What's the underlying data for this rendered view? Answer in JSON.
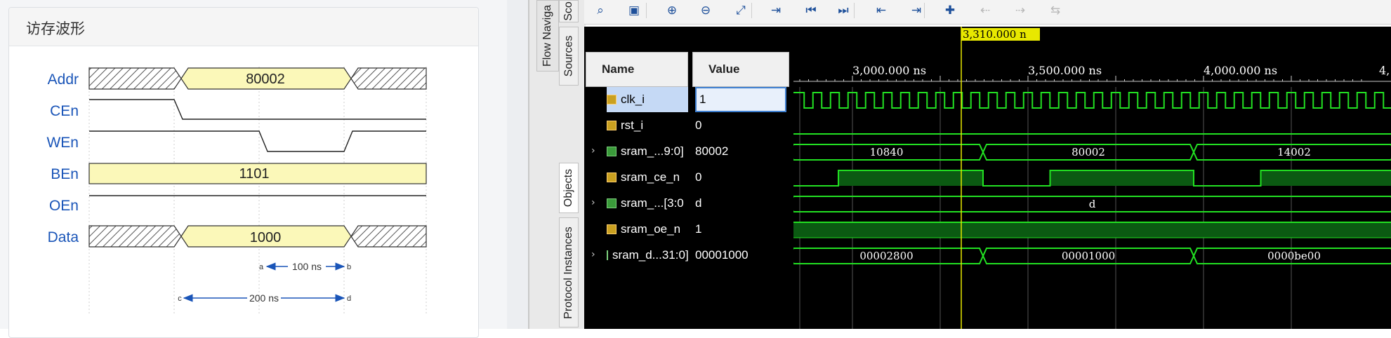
{
  "doc": {
    "title": "访存波形",
    "signals": [
      "Addr",
      "CEn",
      "WEn",
      "BEn",
      "OEn",
      "Data"
    ],
    "addr_value": "80002",
    "ben_value": "1101",
    "data_value": "1000",
    "annotations": {
      "a": "a",
      "b": "b",
      "c": "c",
      "d": "d",
      "short_span": "100 ns",
      "long_span": "200 ns"
    }
  },
  "side_tabs": [
    "Sco",
    "Flow Naviga",
    "Sources",
    "Objects",
    "Protocol Instances"
  ],
  "toolbar": {
    "buttons": [
      {
        "name": "search-button",
        "icon": "search-icon",
        "enabled": true
      },
      {
        "name": "save-button",
        "icon": "save-icon",
        "enabled": true
      },
      {
        "name": "zoom-in-button",
        "icon": "zoom-in-icon",
        "enabled": true
      },
      {
        "name": "zoom-out-button",
        "icon": "zoom-out-icon",
        "enabled": true
      },
      {
        "name": "zoom-fit-button",
        "icon": "zoom-fit-icon",
        "enabled": true
      },
      {
        "name": "go-to-cursor-button",
        "icon": "go-to-cursor-icon",
        "enabled": true
      },
      {
        "name": "go-to-time-0-button",
        "icon": "go-to-start-icon",
        "enabled": true
      },
      {
        "name": "go-to-last-time-button",
        "icon": "go-to-end-icon",
        "enabled": true
      },
      {
        "name": "previous-transition-button",
        "icon": "previous-transition-icon",
        "enabled": true
      },
      {
        "name": "next-transition-button",
        "icon": "next-transition-icon",
        "enabled": true
      },
      {
        "name": "add-marker-button",
        "icon": "add-marker-icon",
        "enabled": true
      },
      {
        "name": "previous-marker-button",
        "icon": "previous-marker-icon",
        "enabled": false
      },
      {
        "name": "next-marker-button",
        "icon": "next-marker-icon",
        "enabled": false
      },
      {
        "name": "swap-cursors-button",
        "icon": "swap-cursors-icon",
        "enabled": false
      }
    ]
  },
  "waveform": {
    "cursor_label": "3,310.000 n",
    "columns": {
      "name": "Name",
      "value": "Value"
    },
    "ticks": [
      "3,000.000 ns",
      "3,500.000 ns",
      "4,000.000 ns",
      "4,"
    ],
    "signals": [
      {
        "name": "clk_i",
        "value": "1",
        "kind": "bit",
        "selected": true,
        "expandable": false
      },
      {
        "name": "rst_i",
        "value": "0",
        "kind": "bit",
        "selected": false,
        "expandable": false
      },
      {
        "name": "sram_...9:0]",
        "value": "80002",
        "kind": "bus",
        "selected": false,
        "expandable": true
      },
      {
        "name": "sram_ce_n",
        "value": "0",
        "kind": "bit",
        "selected": false,
        "expandable": false
      },
      {
        "name": "sram_...[3:0",
        "value": "d",
        "kind": "bus",
        "selected": false,
        "expandable": true
      },
      {
        "name": "sram_oe_n",
        "value": "1",
        "kind": "bit",
        "selected": false,
        "expandable": false
      },
      {
        "name": "sram_d...31:0]",
        "value": "00001000",
        "kind": "bus",
        "selected": false,
        "expandable": true
      }
    ],
    "addr_segments": [
      "10840",
      "80002",
      "14002"
    ],
    "be_segments": [
      "d"
    ],
    "data_segments": [
      "00002800",
      "00001000",
      "0000be00"
    ],
    "wave_color": "#22e022",
    "cursor_color": "#e8e800"
  }
}
